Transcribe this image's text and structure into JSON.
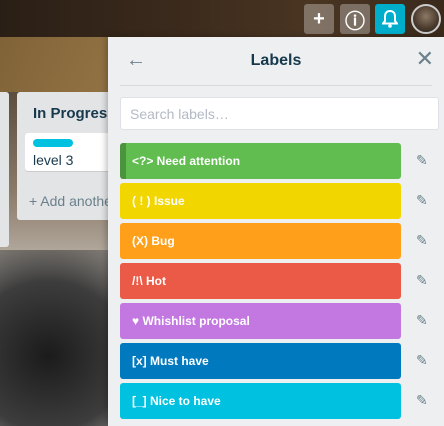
{
  "header": {
    "add_icon": "+",
    "info_icon": "ⓘ",
    "bell_icon": "🔔",
    "accent": "#00aecc"
  },
  "list": {
    "title": "In Progress",
    "card": {
      "title": "level 3",
      "label_color": "#00c2e0"
    },
    "add_card": "+ Add anothe"
  },
  "popover": {
    "title": "Labels",
    "back_icon": "←",
    "close_icon": "✕",
    "search_placeholder": "Search labels…",
    "edit_icon": "✎",
    "labels": [
      {
        "name": "<?> Need attention",
        "color": "#61bd4f"
      },
      {
        "name": "( ! ) Issue",
        "color": "#f2d600"
      },
      {
        "name": "(X) Bug",
        "color": "#ff9f1a"
      },
      {
        "name": "/!\\ Hot",
        "color": "#eb5a46"
      },
      {
        "name": "♥ Whishlist proposal",
        "color": "#c377e0"
      },
      {
        "name": "[x] Must have",
        "color": "#0079bf"
      },
      {
        "name": "[_] Nice to have",
        "color": "#00c2e0"
      }
    ]
  }
}
